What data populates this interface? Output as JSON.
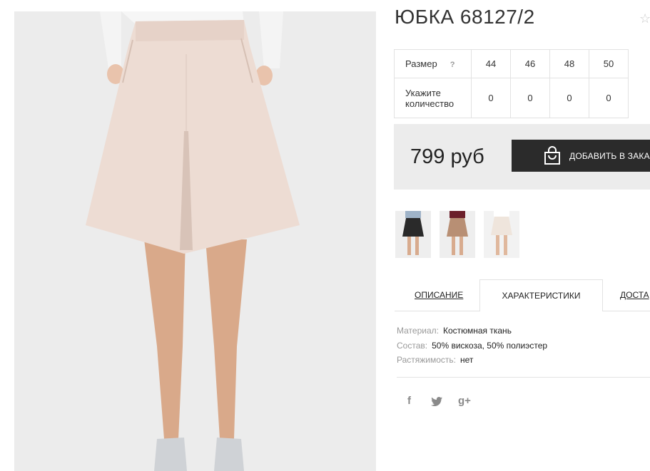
{
  "product": {
    "title": "ЮБКА 68127/2",
    "main_image_alt": "skirt-photo",
    "fav_icon": "star-outline-icon"
  },
  "sizes": {
    "header_label": "Размер",
    "help_icon": "?",
    "quantity_label_line1": "Укажите",
    "quantity_label_line2": "количество",
    "values": [
      "44",
      "46",
      "48",
      "50"
    ],
    "quantities": [
      "0",
      "0",
      "0",
      "0"
    ]
  },
  "price": {
    "text": "799 руб",
    "add_to_cart_label": "ДОБАВИТЬ В ЗАКА",
    "button_color": "#2b2b2b",
    "box_color": "#ececec"
  },
  "thumbnails": [
    {
      "name": "thumb-black-skirt",
      "color": "#2a2a2a"
    },
    {
      "name": "thumb-beige-skirt",
      "color": "#b88f74"
    },
    {
      "name": "thumb-cream-skirt",
      "color": "#eeeae4"
    }
  ],
  "tabs": [
    {
      "label": "ОПИСАНИЕ"
    },
    {
      "label": "ХАРАКТЕРИСТИКИ"
    },
    {
      "label": "ДОСТА"
    }
  ],
  "specs": [
    {
      "key": "Материал:",
      "value": "Костюмная ткань"
    },
    {
      "key": "Состав:",
      "value": "50% вискоза, 50% полиэстер"
    },
    {
      "key": "Растяжимость:",
      "value": "нет"
    }
  ],
  "social": {
    "facebook": "f",
    "twitter": "twitter-icon",
    "google_plus": "g+"
  }
}
